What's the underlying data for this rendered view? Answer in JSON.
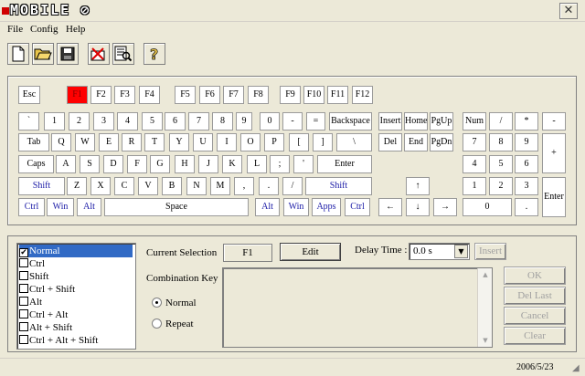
{
  "app": {
    "logo_text": "MOBILE"
  },
  "menu": {
    "file": "File",
    "config": "Config",
    "help": "Help"
  },
  "toolbar": [
    "new-icon",
    "open-icon",
    "save-icon",
    "delete-icon",
    "find-icon",
    "help-icon"
  ],
  "keyboard": {
    "row_fn": [
      "Esc",
      "F1",
      "F2",
      "F3",
      "F4",
      "F5",
      "F6",
      "F7",
      "F8",
      "F9",
      "F10",
      "F11",
      "F12"
    ],
    "row_num": [
      "`",
      "1",
      "2",
      "3",
      "4",
      "5",
      "6",
      "7",
      "8",
      "9",
      "0",
      "-",
      "=",
      "Backspace"
    ],
    "row_tab": [
      "Tab",
      "Q",
      "W",
      "E",
      "R",
      "T",
      "Y",
      "U",
      "I",
      "O",
      "P",
      "[",
      "]",
      "\\"
    ],
    "row_caps": [
      "Caps",
      "A",
      "S",
      "D",
      "F",
      "G",
      "H",
      "J",
      "K",
      "L",
      ";",
      "'",
      "Enter"
    ],
    "row_shift": [
      "Shift",
      "Z",
      "X",
      "C",
      "V",
      "B",
      "N",
      "M",
      ",",
      ".",
      "/",
      "Shift"
    ],
    "row_ctrl": [
      "Ctrl",
      "Win",
      "Alt",
      "Space",
      "Alt",
      "Win",
      "Apps",
      "Ctrl"
    ],
    "nav": [
      "Insert",
      "Home",
      "PgUp",
      "Del",
      "End",
      "PgDn"
    ],
    "arrows": [
      "↑",
      "←",
      "↓",
      "→"
    ],
    "numpad": [
      "Num",
      "/",
      "*",
      "-",
      "7",
      "8",
      "9",
      "+",
      "4",
      "5",
      "6",
      "1",
      "2",
      "3",
      "Enter",
      "0",
      "."
    ],
    "selected_key": "F1"
  },
  "modifiers": {
    "items": [
      {
        "label": "Normal",
        "checked": true,
        "active": true
      },
      {
        "label": "Ctrl",
        "checked": false
      },
      {
        "label": "Shift",
        "checked": false
      },
      {
        "label": "Ctrl + Shift",
        "checked": false
      },
      {
        "label": "Alt",
        "checked": false
      },
      {
        "label": "Ctrl + Alt",
        "checked": false
      },
      {
        "label": "Alt + Shift",
        "checked": false
      },
      {
        "label": "Ctrl + Alt + Shift",
        "checked": false
      }
    ]
  },
  "editor": {
    "current_selection_label": "Current Selection",
    "current_selection_value": "F1",
    "edit_button": "Edit",
    "delay_label": "Delay Time :",
    "delay_value": "0.0 s",
    "insert_button": "Insert",
    "combination_label": "Combination Key",
    "radio_normal": "Normal",
    "radio_repeat": "Repeat",
    "ok_button": "OK",
    "del_last_button": "Del Last",
    "cancel_button": "Cancel",
    "clear_button": "Clear"
  },
  "status": {
    "date": "2006/5/23"
  },
  "colors": {
    "selected_key": "#ff0000",
    "modifier_text": "#1a1aa6",
    "list_highlight": "#316ac5"
  }
}
